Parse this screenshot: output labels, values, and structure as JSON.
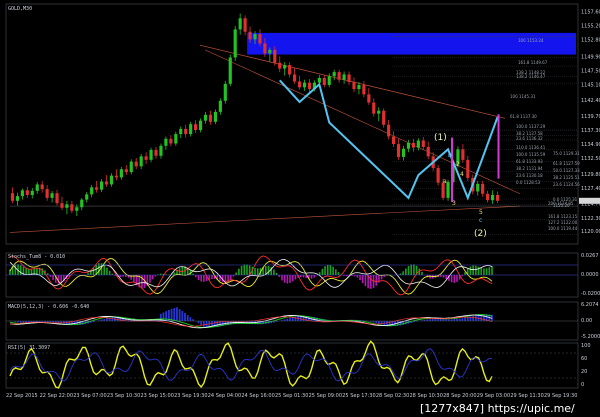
{
  "symbol_label": "GOLD,M30",
  "sub_labels": {
    "ind1": "Stochs_Tum8 - 0.010",
    "ind2": "MACD(5,12,3) - 0.606  -0.640",
    "ind3": "RSI(5) 31.3097"
  },
  "watermark": "[1277x847] https://upic.me/",
  "price_axis": [
    "1157.60",
    "1155.20",
    "1152.80",
    "1149.90",
    "1147.50",
    "1145.10",
    "1142.40",
    "1139.70",
    "1137.30",
    "1134.90",
    "1132.50",
    "1129.80",
    "1127.40",
    "1124.70",
    "1122.30",
    "1120.00"
  ],
  "ind1_axis": [
    "0.0267",
    "0.0000",
    "-0.0200"
  ],
  "ind2_axis": [
    "6.2074",
    "0.00",
    "-5.2000"
  ],
  "ind3_axis": [
    "100",
    "60",
    "20",
    "0"
  ],
  "time_axis": [
    "22 Sep 2015",
    "22 Sep 22:00",
    "23 Sep 07:00",
    "23 Sep 10:30",
    "23 Sep 15:00",
    "23 Sep 19:30",
    "24 Sep 04:00",
    "24 Sep 16:00",
    "25 Sep 01:30",
    "25 Sep 09:00",
    "25 Sep 17:30",
    "28 Sep 02:30",
    "28 Sep 10:30",
    "28 Sep 20:00",
    "29 Sep 03:00",
    "29 Sep 11:30",
    "29 Sep 19:30"
  ],
  "fib_labels": {
    "upper": [
      "100 1153.24",
      "161.8 1149.67",
      "138.2 1148.22",
      "138.2 1146.47",
      "100 1145.31",
      "61.8 1137.30",
      "100.0 1137.29",
      "38.2 1137.58",
      "23.6 1136.32",
      "110.0 1136.41",
      "100.0 1135.59",
      "61.8 1133.93",
      "38.2 1131.94",
      "23.6 1130.18",
      "0.0 1128.53"
    ],
    "lower": [
      "200 1124.85",
      "161.8 1123.15",
      "127.2 1122.00",
      "100.0 1119.44"
    ],
    "right": [
      "75.0 1129.31",
      "61.8 1127.59",
      "50.0 1127.33",
      "38.2 1125.51",
      "23.6 1124.56",
      "0.0 1125.31",
      "1125.20"
    ]
  },
  "wave_labels": {
    "w1": "(1)",
    "w2": "(2)",
    "b": "b",
    "a": "a",
    "c": "c",
    "n2": "2",
    "n3": "3",
    "n4": "4",
    "n5": "5"
  },
  "chart_data": {
    "type": "candlestick",
    "instrument": "GOLD",
    "timeframe": "M30",
    "ylim": [
      1118.5,
      1158.5
    ],
    "x_range": [
      "22 Sep 2015",
      "29 Sep 19:30"
    ],
    "grid": false,
    "colors": {
      "background": "#000000",
      "up_candle": "#22c322",
      "down_candle": "#e03030",
      "resistance_zone": "#1414ee",
      "wave_lines": "#53c5f0",
      "projection": "#d43ad8"
    },
    "candles": [
      [
        1126.5,
        1127.5,
        1124.8,
        1125.2
      ],
      [
        1125.2,
        1126.6,
        1124.4,
        1126.0
      ],
      [
        1126.0,
        1127.3,
        1125.4,
        1127.0
      ],
      [
        1127.0,
        1127.6,
        1125.7,
        1126.2
      ],
      [
        1126.2,
        1127.4,
        1125.6,
        1126.9
      ],
      [
        1126.9,
        1128.4,
        1126.4,
        1128.0
      ],
      [
        1128.0,
        1128.6,
        1126.6,
        1127.2
      ],
      [
        1127.2,
        1127.9,
        1125.2,
        1125.7
      ],
      [
        1125.7,
        1126.9,
        1124.9,
        1126.5
      ],
      [
        1126.5,
        1127.1,
        1124.4,
        1124.8
      ],
      [
        1124.8,
        1125.9,
        1123.6,
        1124.0
      ],
      [
        1124.0,
        1125.2,
        1122.9,
        1124.6
      ],
      [
        1124.6,
        1125.2,
        1123.1,
        1123.5
      ],
      [
        1123.5,
        1124.6,
        1122.6,
        1124.1
      ],
      [
        1124.1,
        1125.7,
        1123.6,
        1125.4
      ],
      [
        1125.4,
        1126.7,
        1124.9,
        1126.3
      ],
      [
        1126.3,
        1127.9,
        1125.8,
        1127.5
      ],
      [
        1127.5,
        1128.6,
        1126.6,
        1127.1
      ],
      [
        1127.1,
        1128.9,
        1126.7,
        1128.5
      ],
      [
        1128.5,
        1129.6,
        1127.6,
        1128.0
      ],
      [
        1128.0,
        1129.9,
        1127.6,
        1129.5
      ],
      [
        1129.5,
        1130.6,
        1128.7,
        1129.2
      ],
      [
        1129.2,
        1131.0,
        1128.8,
        1130.6
      ],
      [
        1130.6,
        1131.3,
        1129.6,
        1130.1
      ],
      [
        1130.1,
        1132.3,
        1129.7,
        1131.9
      ],
      [
        1131.9,
        1132.5,
        1130.6,
        1131.1
      ],
      [
        1131.1,
        1133.2,
        1130.6,
        1132.8
      ],
      [
        1132.8,
        1133.5,
        1131.5,
        1132.2
      ],
      [
        1132.2,
        1134.3,
        1131.8,
        1133.9
      ],
      [
        1133.9,
        1134.4,
        1132.4,
        1132.9
      ],
      [
        1132.9,
        1135.0,
        1132.4,
        1134.6
      ],
      [
        1134.6,
        1136.2,
        1133.9,
        1135.8
      ],
      [
        1135.8,
        1136.4,
        1134.5,
        1135.0
      ],
      [
        1135.0,
        1137.0,
        1134.6,
        1136.6
      ],
      [
        1136.6,
        1137.9,
        1135.9,
        1137.5
      ],
      [
        1137.5,
        1138.2,
        1136.0,
        1136.6
      ],
      [
        1136.6,
        1138.7,
        1136.2,
        1138.3
      ],
      [
        1138.3,
        1139.0,
        1136.8,
        1137.3
      ],
      [
        1137.3,
        1139.3,
        1136.9,
        1138.9
      ],
      [
        1138.9,
        1140.4,
        1138.4,
        1139.9
      ],
      [
        1139.9,
        1140.6,
        1138.2,
        1138.7
      ],
      [
        1138.7,
        1140.8,
        1138.3,
        1140.4
      ],
      [
        1140.4,
        1142.7,
        1139.9,
        1142.3
      ],
      [
        1142.3,
        1145.7,
        1141.8,
        1145.2
      ],
      [
        1145.2,
        1150.2,
        1144.8,
        1149.7
      ],
      [
        1149.7,
        1155.1,
        1149.1,
        1154.5
      ],
      [
        1154.5,
        1157.2,
        1153.6,
        1156.4
      ],
      [
        1156.4,
        1156.9,
        1153.5,
        1154.1
      ],
      [
        1154.1,
        1155.0,
        1152.2,
        1152.8
      ],
      [
        1152.8,
        1154.2,
        1152.0,
        1153.7
      ],
      [
        1153.7,
        1154.5,
        1151.6,
        1152.1
      ],
      [
        1152.1,
        1153.0,
        1149.8,
        1150.4
      ],
      [
        1150.4,
        1151.4,
        1149.0,
        1151.0
      ],
      [
        1151.0,
        1151.6,
        1148.3,
        1148.8
      ],
      [
        1148.8,
        1149.9,
        1147.2,
        1147.8
      ],
      [
        1147.8,
        1148.9,
        1146.6,
        1148.4
      ],
      [
        1148.4,
        1148.9,
        1146.3,
        1146.8
      ],
      [
        1146.8,
        1147.9,
        1145.2,
        1145.6
      ],
      [
        1145.6,
        1146.6,
        1144.2,
        1144.6
      ],
      [
        1144.6,
        1145.9,
        1144.0,
        1145.4
      ],
      [
        1145.4,
        1146.0,
        1143.7,
        1144.3
      ],
      [
        1144.3,
        1145.8,
        1143.9,
        1145.4
      ],
      [
        1145.4,
        1146.7,
        1144.9,
        1146.2
      ],
      [
        1146.2,
        1146.7,
        1144.6,
        1145.0
      ],
      [
        1145.0,
        1147.0,
        1144.6,
        1146.5
      ],
      [
        1146.5,
        1147.6,
        1145.8,
        1147.2
      ],
      [
        1147.2,
        1147.6,
        1145.4,
        1145.9
      ],
      [
        1145.9,
        1147.3,
        1145.2,
        1146.8
      ],
      [
        1146.8,
        1147.3,
        1145.0,
        1145.5
      ],
      [
        1145.5,
        1146.3,
        1143.8,
        1144.3
      ],
      [
        1144.3,
        1145.5,
        1143.4,
        1145.0
      ],
      [
        1145.0,
        1145.7,
        1142.9,
        1143.4
      ],
      [
        1143.4,
        1144.5,
        1141.6,
        1142.0
      ],
      [
        1142.0,
        1142.7,
        1139.6,
        1140.1
      ],
      [
        1140.1,
        1141.2,
        1138.8,
        1140.6
      ],
      [
        1140.6,
        1141.0,
        1137.7,
        1138.2
      ],
      [
        1138.2,
        1139.0,
        1135.7,
        1136.2
      ],
      [
        1136.2,
        1137.1,
        1134.4,
        1134.9
      ],
      [
        1134.9,
        1135.8,
        1132.2,
        1132.7
      ],
      [
        1132.7,
        1134.6,
        1132.1,
        1134.1
      ],
      [
        1134.1,
        1135.6,
        1133.5,
        1135.1
      ],
      [
        1135.1,
        1135.8,
        1133.6,
        1134.3
      ],
      [
        1134.3,
        1135.9,
        1133.8,
        1135.5
      ],
      [
        1135.5,
        1136.1,
        1133.9,
        1134.4
      ],
      [
        1134.4,
        1135.3,
        1132.3,
        1132.8
      ],
      [
        1132.8,
        1133.5,
        1130.3,
        1130.8
      ],
      [
        1130.8,
        1131.3,
        1127.8,
        1128.3
      ],
      [
        1128.3,
        1129.0,
        1125.3,
        1125.7
      ],
      [
        1125.7,
        1128.8,
        1125.2,
        1128.4
      ],
      [
        1128.4,
        1131.9,
        1127.9,
        1131.4
      ],
      [
        1131.4,
        1134.5,
        1130.9,
        1134.0
      ],
      [
        1134.0,
        1134.9,
        1131.7,
        1132.2
      ],
      [
        1132.2,
        1132.9,
        1128.6,
        1129.1
      ],
      [
        1129.1,
        1129.7,
        1126.3,
        1126.8
      ],
      [
        1126.8,
        1128.6,
        1126.1,
        1128.1
      ],
      [
        1128.1,
        1128.6,
        1125.9,
        1126.4
      ],
      [
        1126.4,
        1126.9,
        1124.9,
        1125.3
      ],
      [
        1125.3,
        1127.0,
        1124.7,
        1126.2
      ],
      [
        1126.2,
        1126.8,
        1124.8,
        1125.2
      ]
    ],
    "resistance_zone": {
      "from": "24 Sep 17:00",
      "to": "29 Sep 19:30",
      "low": 1150.2,
      "high": 1153.9
    },
    "current_price": 1125.2,
    "series": [
      {
        "name": "wave path",
        "points": [
          [
            54,
            1145.8
          ],
          [
            58,
            1142.1
          ],
          [
            62,
            1145.1
          ],
          [
            64,
            1138.6
          ],
          [
            80,
            1125.7
          ],
          [
            82,
            1129.6
          ],
          [
            88,
            1134.0
          ],
          [
            92,
            1125.7
          ],
          [
            98,
            1139.5
          ]
        ]
      }
    ]
  }
}
